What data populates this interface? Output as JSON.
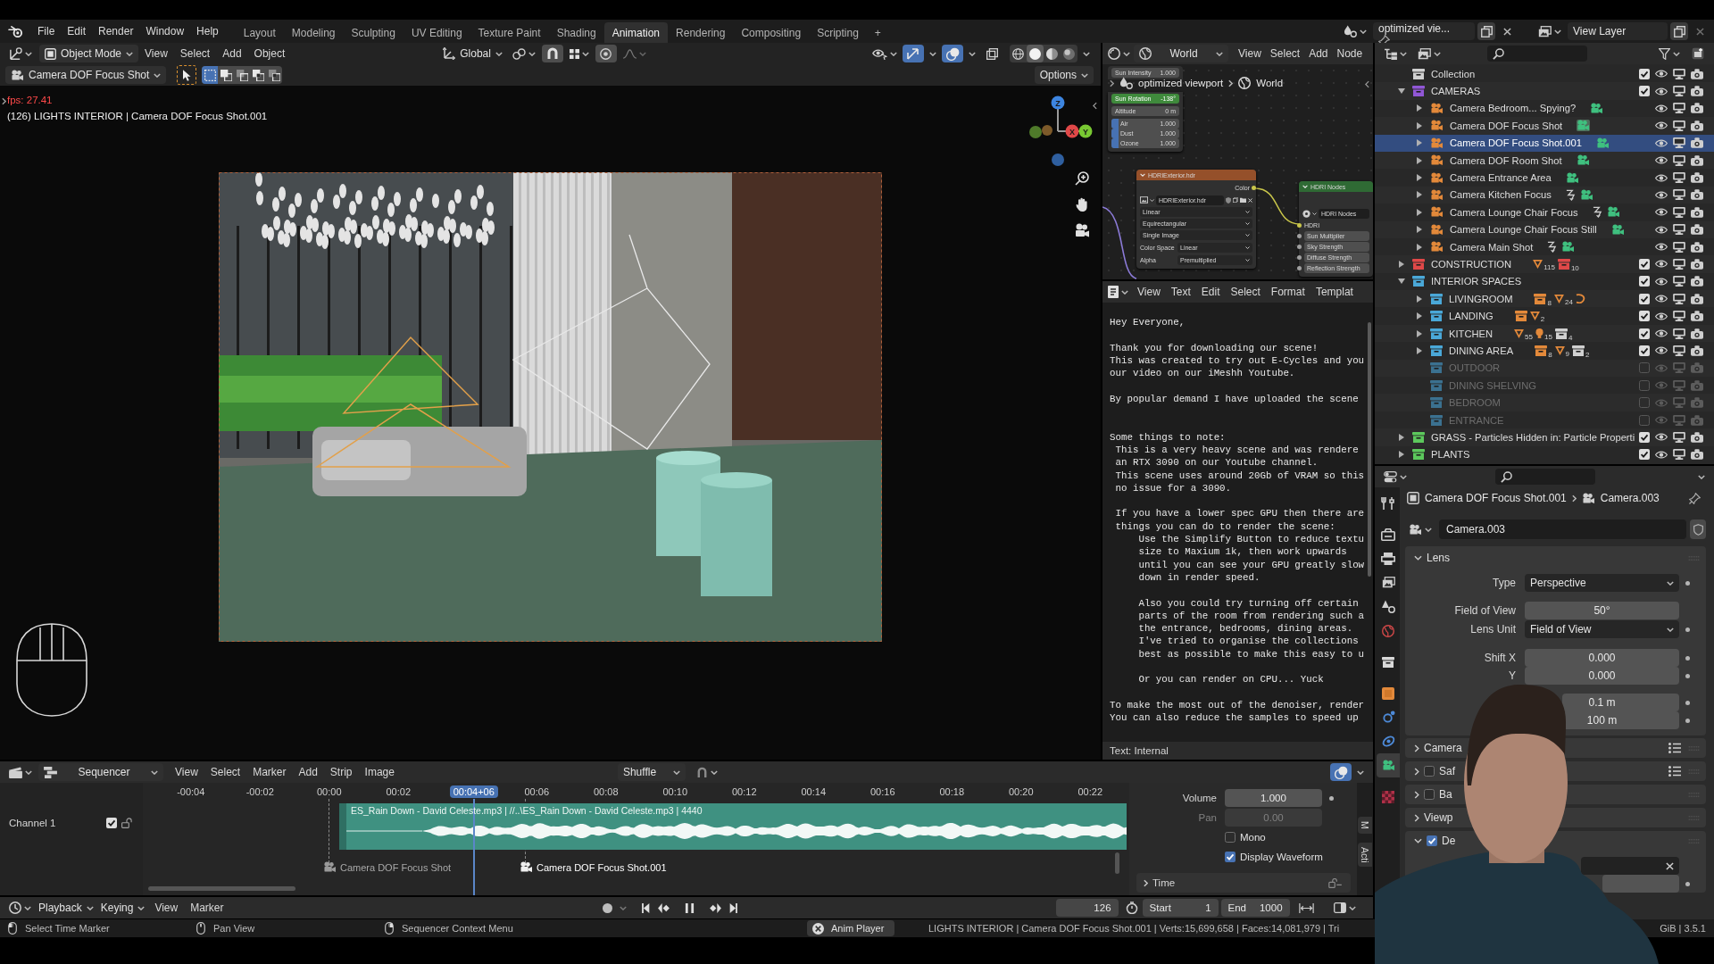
{
  "topbar": {
    "menus": [
      "File",
      "Edit",
      "Render",
      "Window",
      "Help"
    ],
    "workspaces": [
      {
        "label": "Layout",
        "selected": false
      },
      {
        "label": "Modeling",
        "selected": false
      },
      {
        "label": "Sculpting",
        "selected": false
      },
      {
        "label": "UV Editing",
        "selected": false
      },
      {
        "label": "Texture Paint",
        "selected": false
      },
      {
        "label": "Shading",
        "selected": false
      },
      {
        "label": "Animation",
        "selected": true
      },
      {
        "label": "Rendering",
        "selected": false
      },
      {
        "label": "Compositing",
        "selected": false
      },
      {
        "label": "Scripting",
        "selected": false
      }
    ],
    "add_workspace": "+",
    "scene": "optimized vie...",
    "view_layer": "View Layer"
  },
  "viewport": {
    "mode": "Object Mode",
    "menus": [
      "View",
      "Select",
      "Add",
      "Object"
    ],
    "orientation": "Global",
    "gizmos_on": true,
    "overlays_on": true,
    "xray_on": false,
    "shading": [
      {
        "kind": "wireframe",
        "selected": false
      },
      {
        "kind": "solid",
        "selected": true
      },
      {
        "kind": "material",
        "selected": false
      },
      {
        "kind": "rendered",
        "selected": false
      }
    ],
    "active_camera": "Camera DOF Focus Shot",
    "select_modes": [
      {
        "selected": true
      },
      {
        "selected": false
      },
      {
        "selected": false
      },
      {
        "selected": false
      },
      {
        "selected": false
      }
    ],
    "options": "Options",
    "fps": "fps: 27.41",
    "info": "(126) LIGHTS INTERIOR | Camera DOF Focus Shot.001",
    "gizmo_labels": [
      "X",
      "Y",
      "Z"
    ]
  },
  "node_editor": {
    "shader": "World",
    "menus": [
      "View",
      "Select",
      "Add",
      "Node"
    ],
    "breadcrumbs": [
      "optimized viewport",
      "World"
    ],
    "sky_node": {
      "rows": [
        {
          "kind": "field",
          "label": "Sun Intensity",
          "value": "1.000",
          "keyframed": false
        },
        {
          "kind": "field",
          "label": "Sun Rotation",
          "value": "-138°",
          "keyframed": true
        },
        {
          "kind": "field",
          "label": "Altitude",
          "value": "0 m",
          "keyframed": false
        },
        {
          "kind": "slider",
          "label": "Air",
          "value": "1.000",
          "keyframed": false,
          "level": 0.1
        },
        {
          "kind": "slider",
          "label": "Dust",
          "value": "1.000",
          "keyframed": false,
          "level": 0.1
        },
        {
          "kind": "slider",
          "label": "Ozone",
          "value": "1.000",
          "keyframed": false,
          "level": 0.1
        }
      ]
    },
    "image_node": {
      "title": "HDRIExterior.hdr",
      "output": "Color",
      "image": "HDRIExterior.hdr",
      "options": [
        "Linear",
        "Equirectangular",
        "Single Image"
      ],
      "properties": [
        {
          "label": "Color Space",
          "value": "Linear"
        },
        {
          "label": "Alpha",
          "value": "Premultiplied"
        }
      ]
    },
    "group_node": {
      "title": "HDRI Nodes",
      "group": "HDRI Nodes",
      "input": "HDRI",
      "fields": [
        "Sun Multiplier",
        "Sky Strength",
        "Diffuse Strength",
        "Reflection Strength"
      ]
    }
  },
  "text_editor": {
    "menus": [
      "View",
      "Text",
      "Edit",
      "Select",
      "Format",
      "Templat"
    ],
    "text": "Hey Everyone,\n\nThank you for downloading our scene!\nThis was created to try out E-Cycles and you\nour video on our iMeshh Youtube.\n\nBy popular demand I have uploaded the scene\n\n\nSome things to note:\n This is a very heavy scene and was rendere\n an RTX 3090 on our Youtube channel.\n This scene uses around 20Gb of VRAM so this\n no issue for a 3090.\n\n If you have a lower spec GPU then there are\n things you can do to render the scene:\n     Use the Simplify Button to reduce textu\n     size to Maxium 1k, then work upwards\n     until you can see your GPU greatly slow\n     down in render speed.\n\n     Also you could try turning off certain\n     parts of the room from rendering such a\n     the entrance, bedrooms, dining areas.\n     I've tried to organise the collections\n     best as possible to make this easy to u\n\n     Or you can render on CPU... Yuck\n\nTo make the most out of the denoiser, render\nYou can also reduce the samples to speed up",
    "footer": "Text: Internal"
  },
  "outliner": {
    "items": [
      {
        "name": "Collection",
        "kind": "collection",
        "color": "#d0d0d0",
        "selected": false,
        "checked": true
      },
      {
        "name": "CAMERAS",
        "kind": "collection",
        "color": "#9157d6",
        "selected": false,
        "checked": true,
        "expanded": true,
        "children": [
          {
            "name": "Camera Bedroom... Spying?",
            "kind": "camera",
            "selected": false,
            "expanded": false,
            "constraint": false,
            "active_camera": false
          },
          {
            "name": "Camera DOF Focus Shot",
            "kind": "camera",
            "selected": false,
            "expanded": false,
            "constraint": false,
            "active_camera": true
          },
          {
            "name": "Camera DOF Focus Shot.001",
            "kind": "camera",
            "selected": true,
            "expanded": false,
            "constraint": false,
            "active_camera": false
          },
          {
            "name": "Camera DOF Room Shot",
            "kind": "camera",
            "selected": false,
            "expanded": false,
            "constraint": false,
            "active_camera": false
          },
          {
            "name": "Camera Entrance Area",
            "kind": "camera",
            "selected": false,
            "expanded": false,
            "constraint": false,
            "active_camera": false
          },
          {
            "name": "Camera Kitchen Focus",
            "kind": "camera",
            "selected": false,
            "expanded": false,
            "constraint": true,
            "active_camera": false
          },
          {
            "name": "Camera Lounge Chair Focus",
            "kind": "camera",
            "selected": false,
            "expanded": false,
            "constraint": true,
            "active_camera": false
          },
          {
            "name": "Camera Lounge Chair Focus Still",
            "kind": "camera",
            "selected": false,
            "expanded": false,
            "constraint": false,
            "active_camera": false
          },
          {
            "name": "Camera Main Shot",
            "kind": "camera",
            "selected": false,
            "expanded": false,
            "constraint": true,
            "active_camera": false
          }
        ]
      },
      {
        "name": "CONSTRUCTION",
        "kind": "collection",
        "color": "#e04848",
        "selected": false,
        "checked": true,
        "expanded": false,
        "contents": [
          {
            "kind": "mesh",
            "count": "115"
          },
          {
            "kind": "collection",
            "count": "10",
            "color": "#e04848"
          }
        ]
      },
      {
        "name": "INTERIOR SPACES",
        "kind": "collection",
        "color": "#4aa8d8",
        "selected": false,
        "checked": true,
        "expanded": true,
        "children": [
          {
            "name": "LIVINGROOM",
            "kind": "collection",
            "color": "#4aa8d8",
            "selected": false,
            "checked": true,
            "expanded": false,
            "contents": [
              {
                "kind": "instance",
                "count": "8"
              },
              {
                "kind": "mesh",
                "count": "24"
              },
              {
                "kind": "curve"
              }
            ]
          },
          {
            "name": "LANDING",
            "kind": "collection",
            "color": "#4aa8d8",
            "selected": false,
            "checked": true,
            "expanded": false,
            "contents": [
              {
                "kind": "instance"
              },
              {
                "kind": "mesh",
                "count": "2"
              }
            ]
          },
          {
            "name": "KITCHEN",
            "kind": "collection",
            "color": "#4aa8d8",
            "selected": false,
            "checked": true,
            "expanded": false,
            "contents": [
              {
                "kind": "mesh",
                "count": "55"
              },
              {
                "kind": "light",
                "count": "15"
              },
              {
                "kind": "collection",
                "count": "4",
                "color": "#d0d0d0"
              }
            ]
          },
          {
            "name": "DINING AREA",
            "kind": "collection",
            "color": "#4aa8d8",
            "selected": false,
            "checked": true,
            "expanded": false,
            "contents": [
              {
                "kind": "instance",
                "count": "8"
              },
              {
                "kind": "mesh",
                "count": "9"
              },
              {
                "kind": "collection",
                "count": "2",
                "color": "#d0d0d0"
              }
            ]
          },
          {
            "name": "OUTDOOR",
            "kind": "collection",
            "color": "#3b7190",
            "selected": false,
            "checked": false
          },
          {
            "name": "DINING SHELVING",
            "kind": "collection",
            "color": "#3b7190",
            "selected": false,
            "checked": false
          },
          {
            "name": "BEDROOM",
            "kind": "collection",
            "color": "#3b7190",
            "selected": false,
            "checked": false
          },
          {
            "name": "ENTRANCE",
            "kind": "collection",
            "color": "#3b7190",
            "selected": false,
            "checked": false
          }
        ]
      },
      {
        "name": "GRASS - Particles Hidden in: Particle Properti",
        "kind": "collection",
        "color": "#5cc85c",
        "selected": false,
        "checked": true,
        "expanded": false
      },
      {
        "name": "PLANTS",
        "kind": "collection",
        "color": "#5cc85c",
        "selected": false,
        "checked": true,
        "expanded": false
      }
    ]
  },
  "properties": {
    "tabs": [
      {
        "kind": "tool",
        "selected": false
      },
      {
        "kind": "render",
        "selected": false
      },
      {
        "kind": "output",
        "selected": false
      },
      {
        "kind": "view_layer",
        "selected": false
      },
      {
        "kind": "scene",
        "selected": false
      },
      {
        "kind": "world",
        "selected": false
      },
      {
        "kind": "collection",
        "selected": false
      },
      {
        "kind": "object",
        "selected": false
      },
      {
        "kind": "physics",
        "selected": false
      },
      {
        "kind": "constraints",
        "selected": false
      },
      {
        "kind": "camera_data",
        "selected": true
      },
      {
        "kind": "texture",
        "selected": false
      }
    ],
    "object": "Camera DOF Focus Shot.001",
    "data": "Camera.003",
    "datablock": "Camera.003",
    "panels": [
      {
        "title": "Lens",
        "expanded": true,
        "rows": [
          {
            "kind": "dropdown",
            "label": "Type",
            "value": "Perspective",
            "keyframe_dot": true
          },
          {
            "kind": "number",
            "label": "Field of View",
            "value": "50°",
            "keyframe_dot": false
          },
          {
            "kind": "dropdown",
            "label": "Lens Unit",
            "value": "Field of View",
            "keyframe_dot": true
          },
          {
            "kind": "number",
            "label": "Shift X",
            "value": "0.000",
            "keyframe_dot": true
          },
          {
            "kind": "number",
            "label": "Y",
            "value": "0.000",
            "keyframe_dot": true
          },
          {
            "kind": "number",
            "value": "0.1 m",
            "keyframe_dot": true
          },
          {
            "kind": "number",
            "value": "100 m",
            "keyframe_dot": true
          }
        ]
      },
      {
        "title": "Camera",
        "expanded": false,
        "presets": true
      },
      {
        "title": "Saf",
        "expanded": false,
        "checked": false,
        "presets": true
      },
      {
        "title": "Ba",
        "expanded": false,
        "checked": false
      },
      {
        "title": "Viewp",
        "expanded": false
      },
      {
        "title": "De",
        "expanded": true,
        "checked": true,
        "rows": [
          {
            "kind": "clear_field",
            "keyframe_dot": false
          },
          {
            "kind": "number",
            "keyframe_dot": true
          }
        ]
      }
    ]
  },
  "sequencer": {
    "view": "Sequencer",
    "menus": [
      "View",
      "Select",
      "Marker",
      "Add",
      "Strip",
      "Image"
    ],
    "overlap_mode": "Shuffle",
    "overlays_on": true,
    "channel": {
      "name": "Channel 1",
      "checked": true,
      "locked": false
    },
    "ruler": [
      "-00:04",
      "-00:02",
      "00:00",
      "00:02",
      "00:06",
      "00:08",
      "00:10",
      "00:12",
      "00:14",
      "00:16",
      "00:18",
      "00:20",
      "00:22"
    ],
    "current_time": "00:04+06",
    "strip": {
      "label": "ES_Rain Down - David Celeste.mp3 | //..\\ES_Rain Down - David Celeste.mp3 | 4440"
    },
    "markers": [
      {
        "label": "Camera DOF Focus Shot",
        "selected": false
      },
      {
        "label": "Camera DOF Focus Shot.001",
        "selected": true
      }
    ],
    "sidebar": {
      "fields": [
        {
          "label": "Volume",
          "value": "1.000",
          "disabled": false
        },
        {
          "label": "Pan",
          "value": "0.00",
          "disabled": true
        }
      ],
      "toggles": [
        {
          "label": "Mono",
          "checked": false
        },
        {
          "label": "Display Waveform",
          "checked": true
        }
      ],
      "panel": "Time"
    },
    "tabs": [
      "M",
      "Acti"
    ]
  },
  "timeline": {
    "dropdowns": [
      "Playback",
      "Keying"
    ],
    "menus": [
      "View",
      "Marker"
    ],
    "auto_keying": false,
    "playing": true,
    "current_frame": "126",
    "start_label": "Start",
    "start": "1",
    "end_label": "End",
    "end": "1000"
  },
  "status": {
    "hints": [
      {
        "kind": "left",
        "label": "Select Time Marker"
      },
      {
        "kind": "middle",
        "label": "Pan View"
      },
      {
        "kind": "right",
        "label": "Sequencer Context Menu"
      }
    ],
    "job": "Anim Player",
    "stats": "LIGHTS INTERIOR | Camera DOF Focus Shot.001 | Verts:15,699,658 | Faces:14,081,979 | Tri",
    "version": "GiB | 3.5.1"
  }
}
